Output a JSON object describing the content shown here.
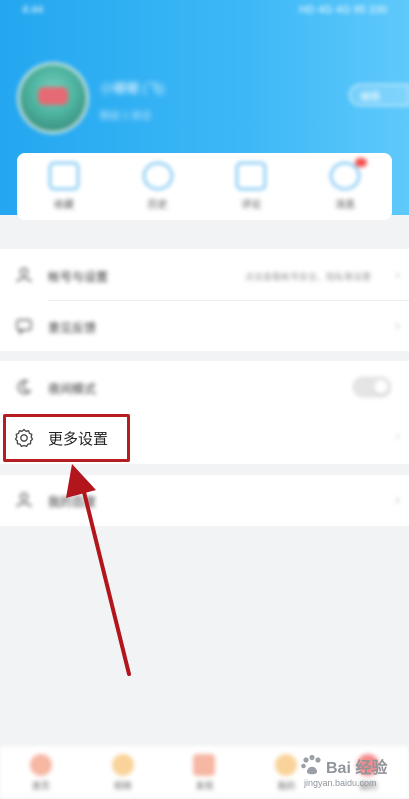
{
  "status_bar": {
    "time": "4:44",
    "right_indicators": "HD 4G 4G 95 100"
  },
  "profile": {
    "username": "小嘟嘟 (飞)",
    "info": "粉丝 2 关注",
    "edit_label": "编辑"
  },
  "quick_actions": [
    {
      "label": "收藏",
      "icon": "favorites-icon"
    },
    {
      "label": "历史",
      "icon": "history-icon"
    },
    {
      "label": "评论",
      "icon": "comment-icon"
    },
    {
      "label": "消息",
      "icon": "message-icon"
    }
  ],
  "menu": {
    "row1": {
      "label": "帐号与设置",
      "sub": "点击查看帐号安全、隐私等设置"
    },
    "row2": {
      "label": "意见反馈"
    },
    "row3": {
      "label": "夜间模式"
    },
    "highlight": {
      "label": "更多设置"
    },
    "row5": {
      "label": "我的百度"
    }
  },
  "bottom_nav": [
    {
      "label": "首页"
    },
    {
      "label": "视频"
    },
    {
      "label": "发现"
    },
    {
      "label": "我的"
    },
    {
      "label": "我的"
    }
  ],
  "watermark": {
    "brand": "Bai 经验",
    "url": "jingyan.baidu.com"
  },
  "colors": {
    "header": "#2aa9f1",
    "highlight_border": "#b61d22",
    "arrow": "#b3151c"
  }
}
